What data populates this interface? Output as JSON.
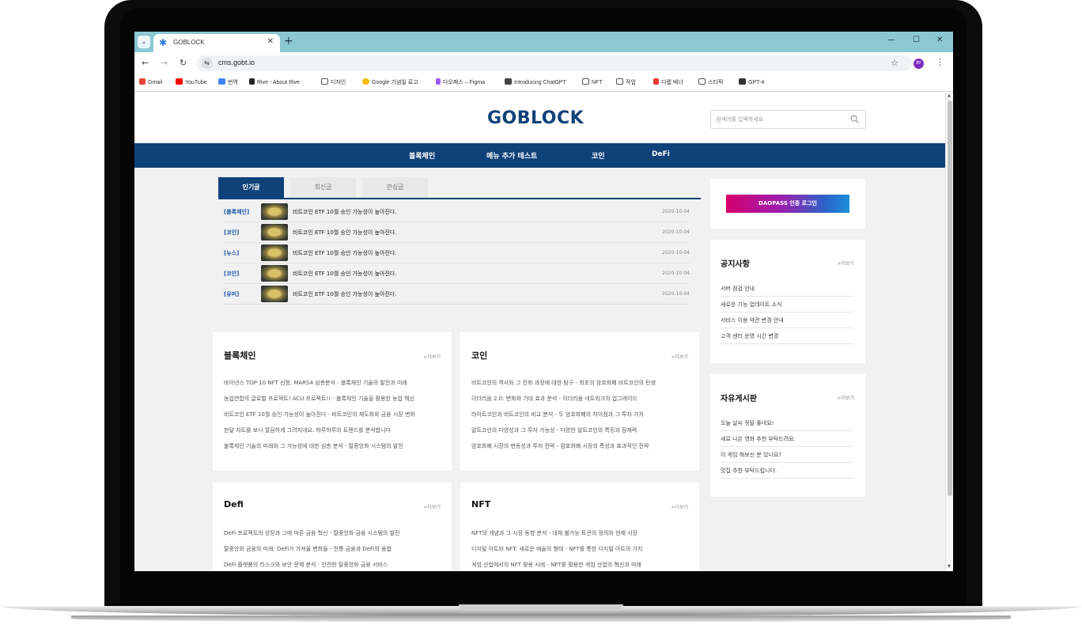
{
  "browser": {
    "tab_title": "GOBLOCK",
    "url": "cms.gobt.io",
    "profile_initials": "BY",
    "bookmarks": [
      "Gmail",
      "YouTube",
      "번역",
      "Rive - About Rive",
      "디자인",
      "Google 기념일 로고",
      "다오패스 – Figma",
      "Introducing ChatGPT",
      "NFT",
      "작업",
      "디렙 배너",
      "스타픽",
      "GPT-4"
    ]
  },
  "site": {
    "logo": "GOBLOCK",
    "search_placeholder": "검색어를 입력하세요",
    "nav": [
      "블록체인",
      "메뉴 추가 테스트",
      "코인",
      "DeFi"
    ]
  },
  "popular": {
    "tabs": [
      "인기글",
      "최신글",
      "관심글"
    ],
    "articles": [
      {
        "category": "[블록체인]",
        "title": "비트코인 ETF 10월 승인 가능성이 높아진다.",
        "date": "2020-10-04"
      },
      {
        "category": "[코인]",
        "title": "비트코인 ETF 10월 승인 가능성이 높아진다.",
        "date": "2020-10-04"
      },
      {
        "category": "[뉴스]",
        "title": "비트코인 ETF 10월 승인 가능성이 높아진다.",
        "date": "2020-10-04"
      },
      {
        "category": "[코인]",
        "title": "비트코인 ETF 10월 승인 가능성이 높아진다.",
        "date": "2020-10-04"
      },
      {
        "category": "[유머]",
        "title": "비트코인 ETF 10월 승인 가능성이 높아진다.",
        "date": "2020-10-04"
      }
    ]
  },
  "cards": {
    "more_label": ">더보기",
    "blockchain": {
      "title": "블록체인",
      "items": [
        "바이낸스 TOP 10 NFT 선정, MARS4 심층분석 - 블록체인 기술의 발전과 미래",
        "농업연합의 글로벌 프로젝트! ACU 프로젝트!! - 블록체인 기술을 활용한 농업 혁신",
        "비트코인 ETF 10월 승인 가능성이 높아진다 - 비트코인의 제도화와 금융 시장 변화",
        "한달 차트를 보니 깔끔하게 그려지네요. 하루하루의 트렌드를 분석합니다",
        "블록체인 기술의 미래와 그 가능성에 대한 심층 분석 - 탈중앙화 시스템의 발전"
      ]
    },
    "coin": {
      "title": "코인",
      "items": [
        "비트코인의 역사와 그 진화 과정에 대한 탐구 - 최초의 암호화폐 비트코인의 탄생",
        "이더리움 2.0: 변화와 기대 효과 분석 - 이더리움 네트워크의 업그레이드",
        "라이트코인과 비트코인의 비교 분석 - 두 암호화폐의 차이점과 그 투자 가치",
        "알트코인의 다양성과 그 투자 가능성 - 다양한 알트코인의 특징과 잠재력",
        "암호화폐 시장의 변동성과 투자 전략 - 암호화폐 시장의 특성과 효과적인 전략"
      ]
    },
    "defi": {
      "title": "Defi",
      "items": [
        "DeFi 프로젝트의 성장과 그에 따른 금융 혁신 - 탈중앙화 금융 시스템의 발전",
        "탈중앙화 금융의 미래: DeFi가 가져올 변화들 - 전통 금융과 DeFi의 융합",
        "DeFi 플랫폼의 리스크와 보안 문제 분석 - 안전한 탈중앙화 금융 서비스"
      ]
    },
    "nft": {
      "title": "NFT",
      "items": [
        "NFT의 개념과 그 시장 동향 분석 - 대체 불가능 토큰의 정의와 현재 시장",
        "디지털 아트와 NFT: 새로운 예술의 형태 - NFT를 통한 디지털 아트의 가치",
        "게임 산업에서의 NFT 활용 사례 - NFT를 활용한 게임 산업의 혁신과 미래"
      ]
    }
  },
  "sidebar": {
    "login_button": "DAOPASS 인증 로그인",
    "notice": {
      "title": "공지사항",
      "more": ">더보기",
      "items": [
        "서버 점검 안내",
        "새로운 기능 업데이트 소식",
        "서비스 이용 약관 변경 안내",
        "고객 센터 운영 시간 변경"
      ]
    },
    "board": {
      "title": "자유게시판",
      "more": ">더보기",
      "items": [
        "오늘 날씨 정말 좋네요!",
        "새로 나온 영화 추천 부탁드려요.",
        "이 게임 해보신 분 있나요?",
        "맛집 추천 부탁드립니다."
      ]
    }
  },
  "colors": {
    "brand_navy": "#10427a",
    "browser_teal": "#8bc8d2",
    "category_blue": "#1a56a8"
  }
}
